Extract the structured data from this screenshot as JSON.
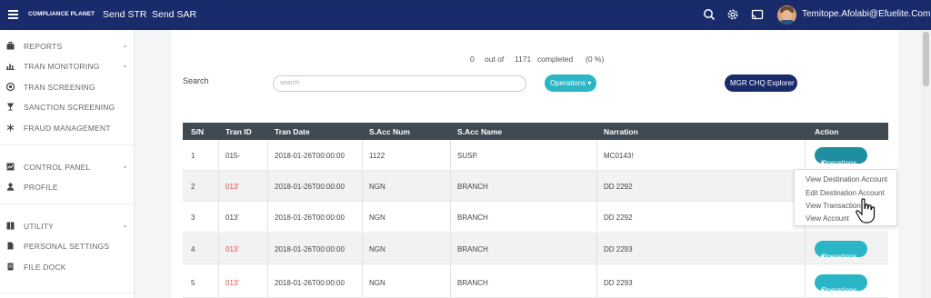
{
  "topbar": {
    "brand": "COMPLIANCE PLANET",
    "nav": [
      "Send STR",
      "Send SAR"
    ],
    "user": "Temitope.Afolabi@Efuelite.Com"
  },
  "sidebar": {
    "items": [
      {
        "label": "REPORTS",
        "icon": "briefcase-icon",
        "chevron": true
      },
      {
        "label": "TRAN MONITORING",
        "icon": "bar-chart-icon",
        "chevron": true
      },
      {
        "label": "TRAN SCREENING",
        "icon": "camera-icon",
        "chevron": false
      },
      {
        "label": "SANCTION SCREENING",
        "icon": "trophy-icon",
        "chevron": false
      },
      {
        "label": "FRAUD MANAGEMENT",
        "icon": "snowflake-icon",
        "chevron": false
      },
      {
        "label": "CONTROL PANEL",
        "icon": "line-chart-icon",
        "chevron": true
      },
      {
        "label": "PROFILE",
        "icon": "user-icon",
        "chevron": false
      },
      {
        "label": "UTILITY",
        "icon": "book-icon",
        "chevron": true
      },
      {
        "label": "PERSONAL SETTINGS",
        "icon": "document-icon",
        "chevron": false
      },
      {
        "label": "FILE DOCK",
        "icon": "file-icon",
        "chevron": false
      }
    ]
  },
  "progress": {
    "done": "0",
    "out_of": "out of",
    "total": "1171",
    "completed": "completed",
    "percent": "(0 %)"
  },
  "search": {
    "label": "Search",
    "placeholder": "search"
  },
  "buttons": {
    "operations": "Operations",
    "mgr": "MGR CHQ Explorer"
  },
  "table": {
    "headers": [
      "S/N",
      "Tran ID",
      "Tran Date",
      "S.Acc Num",
      "S.Acc Name",
      "Narration",
      "Action"
    ],
    "rows": [
      {
        "sn": "1",
        "tran_id": "015‐",
        "date": "2018-01-26T00:00:00",
        "acc_num": "1122",
        "acc_name": "SUSP.",
        "narration": "MC0143!",
        "action": "Operations"
      },
      {
        "sn": "2",
        "tran_id": "013'",
        "date": "2018-01-26T00:00:00",
        "acc_num": "NGN",
        "acc_name": "BRANCH",
        "narration": "DD 2292",
        "action": ""
      },
      {
        "sn": "3",
        "tran_id": "013'",
        "date": "2018-01-26T00:00:00",
        "acc_num": "NGN",
        "acc_name": "BRANCH",
        "narration": "DD 2292",
        "action": ""
      },
      {
        "sn": "4",
        "tran_id": "013'",
        "date": "2018-01-26T00:00:00",
        "acc_num": "NGN",
        "acc_name": "BRANCH",
        "narration": "DD 2293",
        "action": "Operations"
      },
      {
        "sn": "5",
        "tran_id": "013'",
        "date": "2018-01-26T00:00:00",
        "acc_num": "NGN",
        "acc_name": "BRANCH",
        "narration": "DD 2293",
        "action": "Operations"
      }
    ]
  },
  "dropdown": {
    "items": [
      "View Destination Account",
      "Edit Destination Account",
      "View Transaction",
      "View Account"
    ]
  },
  "colors": {
    "navy": "#1a2b6b",
    "teal": "#2bb6c8",
    "header": "#3f4a52",
    "red": "#d9534f"
  }
}
